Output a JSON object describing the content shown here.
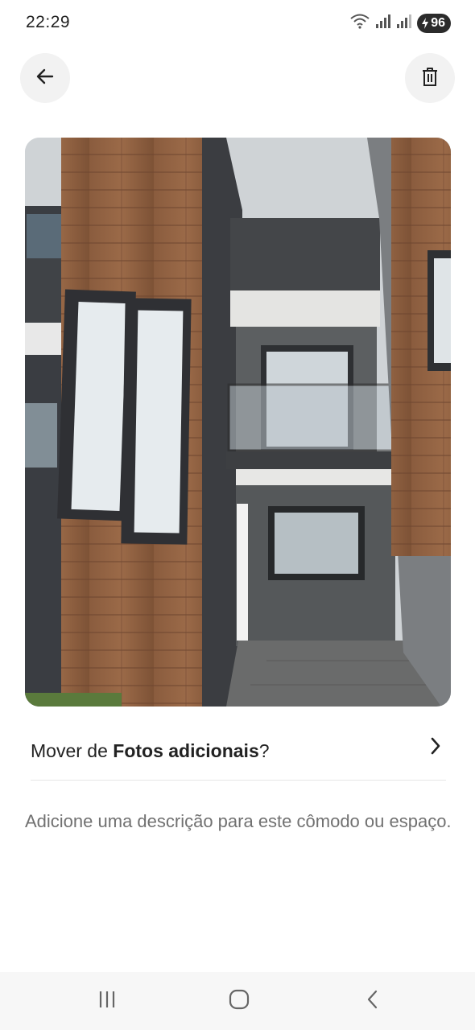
{
  "status_bar": {
    "time": "22:29",
    "battery": "96"
  },
  "photo": {
    "icons": [
      "wifi-icon",
      "signal-icon",
      "battery-icon"
    ]
  },
  "move_row": {
    "prefix": "Mover de ",
    "album": "Fotos adicionais",
    "suffix": "?"
  },
  "description": {
    "placeholder": "Adicione uma descrição para este cômodo ou espaço."
  },
  "nav": {
    "icons": [
      "recents-icon",
      "home-icon",
      "back-icon"
    ]
  },
  "colors": {
    "text": "#222222",
    "muted": "#717171",
    "button_bg": "#f2f2f2"
  }
}
